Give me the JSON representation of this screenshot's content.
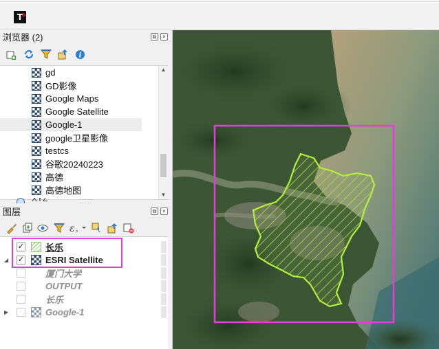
{
  "app": {
    "logo_text": "T",
    "logo_plus": "+"
  },
  "browser": {
    "title": "浏览器 (2)",
    "items": [
      {
        "label": "gd"
      },
      {
        "label": "GD影像"
      },
      {
        "label": "Google Maps"
      },
      {
        "label": "Google Satellite"
      },
      {
        "label": "Google-1",
        "selected": true
      },
      {
        "label": "google卫星影像"
      },
      {
        "label": "testcs"
      },
      {
        "label": "谷歌20240223"
      },
      {
        "label": "高德"
      },
      {
        "label": "高德地图"
      }
    ],
    "partial_item": "XYZ",
    "toolbar_icons": [
      "add-icon",
      "refresh-icon",
      "filter-icon",
      "collapse-icon",
      "info-icon"
    ]
  },
  "layers": {
    "title": "图层",
    "toolbar_icons": [
      "style-brush-icon",
      "add-group-icon",
      "eye-icon",
      "filter-icon",
      "expression-icon",
      "expand-all-icon",
      "collapse-all-icon",
      "remove-layer-icon"
    ],
    "items": [
      {
        "name": "长乐",
        "checked": true,
        "icon": "hatch-polygon",
        "active": true
      },
      {
        "name": "ESRI Satellite",
        "checked": true,
        "icon": "raster-grid",
        "active": true
      },
      {
        "name": "厦门大学",
        "checked": false,
        "icon": "none",
        "active": false
      },
      {
        "name": "OUTPUT",
        "checked": false,
        "icon": "none",
        "active": false
      },
      {
        "name": "长乐",
        "checked": false,
        "icon": "none",
        "active": false
      },
      {
        "name": "Google-1",
        "checked": false,
        "icon": "raster-grid",
        "active": false
      }
    ],
    "check_mark": "✓"
  },
  "colors": {
    "highlight": "#e53ce0",
    "polygon_outline": "#b6f03a",
    "hatch": "#7fcf5a"
  }
}
